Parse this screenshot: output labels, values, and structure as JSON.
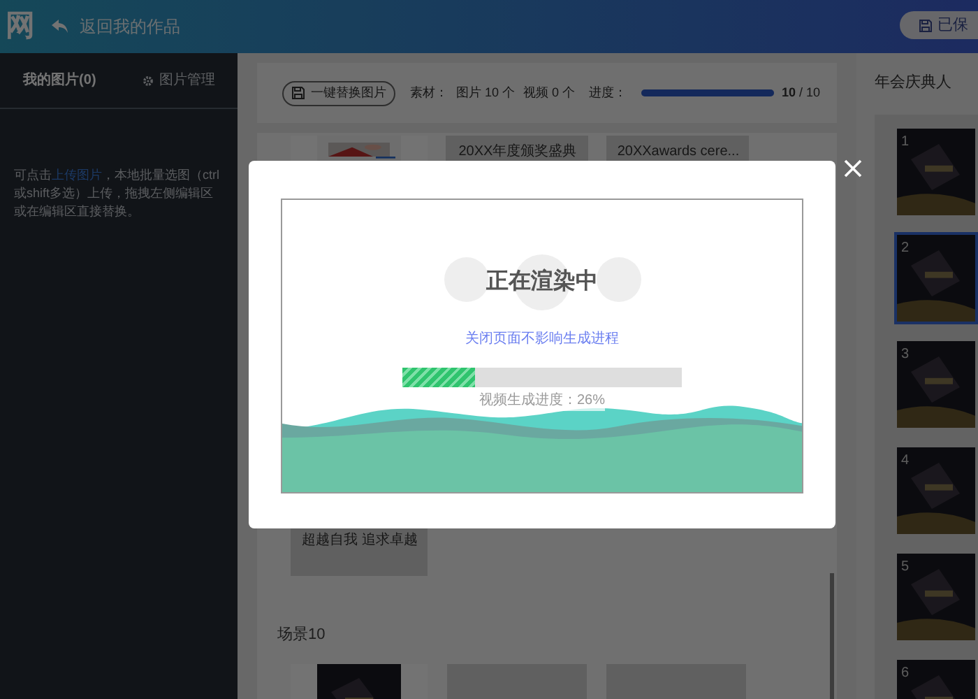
{
  "header": {
    "logo": "网",
    "back_link": "返回我的作品",
    "save_button": "已保"
  },
  "sidebar": {
    "tabs": [
      {
        "label": "我的图片(0)",
        "selected": true
      },
      {
        "label": "图片管理",
        "selected": false
      }
    ],
    "help": {
      "before": "可点击",
      "link": "上传图片",
      "after": "，本地批量选图（ctrl或shift多选）上传，拖拽左侧编辑区或在编辑区直接替换。"
    }
  },
  "toolbar": {
    "replace_button": "一键替换图片",
    "material_label": "素材：",
    "images": "图片 10 个",
    "videos": "视频 0 个",
    "progress_label": "进度：",
    "level": 1.0,
    "done": "10",
    "total": "/ 10"
  },
  "upper_cards": [
    {
      "kind": "picture"
    },
    {
      "kind": "title",
      "text": "20XX年度颁奖盛典"
    },
    {
      "kind": "title",
      "text": "20XXawards cere..."
    }
  ],
  "lower_card": {
    "text": "超越自我 追求卓越"
  },
  "scene_label": "场景10",
  "scene_cards": [
    {
      "kind": "picture"
    },
    {
      "kind": "blank"
    },
    {
      "kind": "blank"
    }
  ],
  "right_panel": {
    "title": "年会庆典人",
    "thumbnails": [
      {
        "number": "1",
        "selected": false
      },
      {
        "number": "2",
        "selected": true
      },
      {
        "number": "3",
        "selected": false
      },
      {
        "number": "4",
        "selected": false
      },
      {
        "number": "5",
        "selected": false
      },
      {
        "number": "6",
        "selected": false
      }
    ]
  },
  "modal": {
    "title": "正在渲染中",
    "note": "关闭页面不影响生成进程",
    "level": 0.26,
    "reading": "视频生成进度：26%"
  }
}
